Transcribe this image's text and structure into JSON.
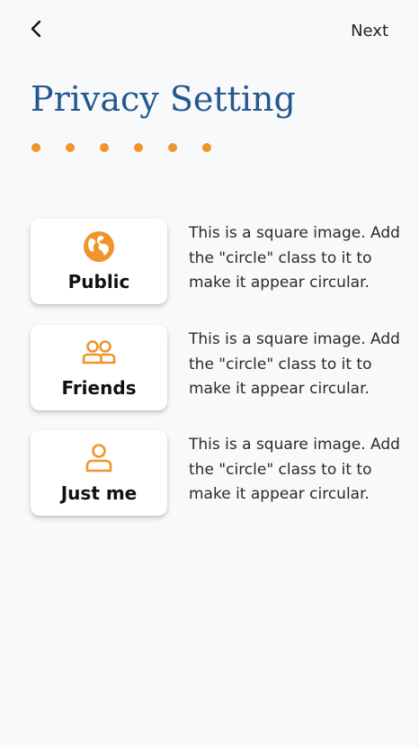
{
  "header": {
    "back_icon": "chevron-left-icon",
    "next_label": "Next"
  },
  "title": "Privacy Setting",
  "progress": {
    "steps": 6,
    "accent_color": "#f0952b"
  },
  "options": [
    {
      "label": "Public",
      "icon": "globe-icon",
      "description": "This is a square image. Add the \"circle\" class to it to make it appear circular."
    },
    {
      "label": "Friends",
      "icon": "people-icon",
      "description": "This is a square image. Add the \"circle\" class to it to make it appear circular."
    },
    {
      "label": "Just me",
      "icon": "person-icon",
      "description": "This is a square image. Add the \"circle\" class to it to make it appear circular."
    }
  ],
  "colors": {
    "title": "#23578e",
    "accent": "#f0952b",
    "background": "#f8f9fb"
  }
}
